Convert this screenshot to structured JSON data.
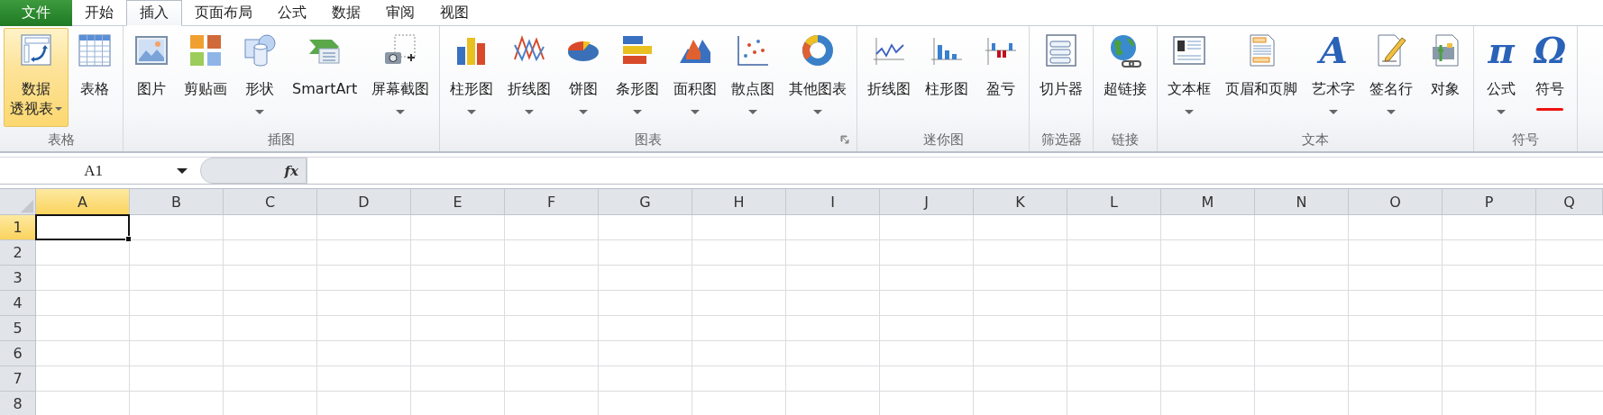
{
  "tabs": [
    {
      "label": "文件",
      "kind": "file",
      "selected": false
    },
    {
      "label": "开始",
      "kind": "tab",
      "selected": false
    },
    {
      "label": "插入",
      "kind": "tab",
      "selected": true
    },
    {
      "label": "页面布局",
      "kind": "tab",
      "selected": false
    },
    {
      "label": "公式",
      "kind": "tab",
      "selected": false
    },
    {
      "label": "数据",
      "kind": "tab",
      "selected": false
    },
    {
      "label": "审阅",
      "kind": "tab",
      "selected": false
    },
    {
      "label": "视图",
      "kind": "tab",
      "selected": false
    }
  ],
  "groups": [
    {
      "label": "表格",
      "launcher": false,
      "buttons": [
        {
          "label_lines": [
            "数据",
            "透视表"
          ],
          "dropdown": true,
          "highlighted": true,
          "underlined": false
        },
        {
          "label_lines": [
            "表格"
          ],
          "dropdown": false,
          "highlighted": false,
          "underlined": false
        }
      ]
    },
    {
      "label": "插图",
      "launcher": false,
      "buttons": [
        {
          "label_lines": [
            "图片"
          ],
          "dropdown": false,
          "highlighted": false,
          "underlined": false
        },
        {
          "label_lines": [
            "剪贴画"
          ],
          "dropdown": false,
          "highlighted": false,
          "underlined": false
        },
        {
          "label_lines": [
            "形状"
          ],
          "dropdown": true,
          "highlighted": false,
          "underlined": false
        },
        {
          "label_lines": [
            "SmartArt"
          ],
          "dropdown": false,
          "highlighted": false,
          "underlined": false
        },
        {
          "label_lines": [
            "屏幕截图"
          ],
          "dropdown": true,
          "highlighted": false,
          "underlined": false
        }
      ]
    },
    {
      "label": "图表",
      "launcher": true,
      "buttons": [
        {
          "label_lines": [
            "柱形图"
          ],
          "dropdown": true,
          "highlighted": false,
          "underlined": false
        },
        {
          "label_lines": [
            "折线图"
          ],
          "dropdown": true,
          "highlighted": false,
          "underlined": false
        },
        {
          "label_lines": [
            "饼图"
          ],
          "dropdown": true,
          "highlighted": false,
          "underlined": false
        },
        {
          "label_lines": [
            "条形图"
          ],
          "dropdown": true,
          "highlighted": false,
          "underlined": false
        },
        {
          "label_lines": [
            "面积图"
          ],
          "dropdown": true,
          "highlighted": false,
          "underlined": false
        },
        {
          "label_lines": [
            "散点图"
          ],
          "dropdown": true,
          "highlighted": false,
          "underlined": false
        },
        {
          "label_lines": [
            "其他图表"
          ],
          "dropdown": true,
          "highlighted": false,
          "underlined": false
        }
      ]
    },
    {
      "label": "迷你图",
      "launcher": false,
      "buttons": [
        {
          "label_lines": [
            "折线图"
          ],
          "dropdown": false,
          "highlighted": false,
          "underlined": false
        },
        {
          "label_lines": [
            "柱形图"
          ],
          "dropdown": false,
          "highlighted": false,
          "underlined": false
        },
        {
          "label_lines": [
            "盈亏"
          ],
          "dropdown": false,
          "highlighted": false,
          "underlined": false
        }
      ]
    },
    {
      "label": "筛选器",
      "launcher": false,
      "buttons": [
        {
          "label_lines": [
            "切片器"
          ],
          "dropdown": false,
          "highlighted": false,
          "underlined": false
        }
      ]
    },
    {
      "label": "链接",
      "launcher": false,
      "buttons": [
        {
          "label_lines": [
            "超链接"
          ],
          "dropdown": false,
          "highlighted": false,
          "underlined": false
        }
      ]
    },
    {
      "label": "文本",
      "launcher": false,
      "buttons": [
        {
          "label_lines": [
            "文本框"
          ],
          "dropdown": true,
          "highlighted": false,
          "underlined": false
        },
        {
          "label_lines": [
            "页眉和页脚"
          ],
          "dropdown": false,
          "highlighted": false,
          "underlined": false
        },
        {
          "glyph": "A",
          "label_lines": [
            "艺术字"
          ],
          "dropdown": true,
          "highlighted": false,
          "underlined": false
        },
        {
          "label_lines": [
            "签名行"
          ],
          "dropdown": true,
          "highlighted": false,
          "underlined": false
        },
        {
          "label_lines": [
            "对象"
          ],
          "dropdown": false,
          "highlighted": false,
          "underlined": false
        }
      ]
    },
    {
      "label": "符号",
      "launcher": false,
      "buttons": [
        {
          "glyph": "π",
          "label_lines": [
            "公式"
          ],
          "dropdown": true,
          "highlighted": false,
          "underlined": false
        },
        {
          "glyph": "Ω",
          "label_lines": [
            "符号"
          ],
          "dropdown": false,
          "highlighted": false,
          "underlined": true
        }
      ]
    }
  ],
  "formula_bar": {
    "name_box": "A1",
    "fx_label": "fx"
  },
  "columns": [
    {
      "label": "A",
      "selected": true
    },
    {
      "label": "B",
      "selected": false
    },
    {
      "label": "C",
      "selected": false
    },
    {
      "label": "D",
      "selected": false
    },
    {
      "label": "E",
      "selected": false
    },
    {
      "label": "F",
      "selected": false
    },
    {
      "label": "G",
      "selected": false
    },
    {
      "label": "H",
      "selected": false
    },
    {
      "label": "I",
      "selected": false
    },
    {
      "label": "J",
      "selected": false
    },
    {
      "label": "K",
      "selected": false
    },
    {
      "label": "L",
      "selected": false
    },
    {
      "label": "M",
      "selected": false
    },
    {
      "label": "N",
      "selected": false
    },
    {
      "label": "O",
      "selected": false
    },
    {
      "label": "P",
      "selected": false
    },
    {
      "label": "Q",
      "selected": false
    }
  ],
  "rows": [
    {
      "label": "1",
      "selected": true
    },
    {
      "label": "2",
      "selected": false
    },
    {
      "label": "3",
      "selected": false
    },
    {
      "label": "4",
      "selected": false
    },
    {
      "label": "5",
      "selected": false
    },
    {
      "label": "6",
      "selected": false
    },
    {
      "label": "7",
      "selected": false
    },
    {
      "label": "8",
      "selected": false
    }
  ]
}
